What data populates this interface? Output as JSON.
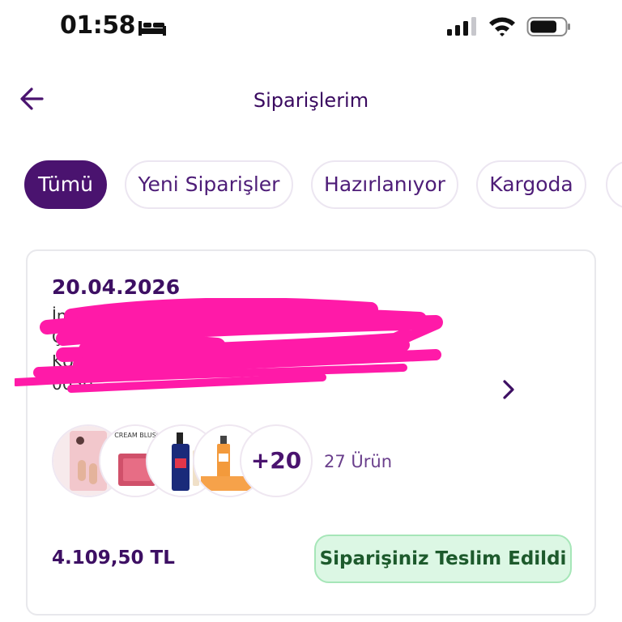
{
  "status_bar": {
    "time": "01:58"
  },
  "header": {
    "title": "Siparişlerim"
  },
  "tabs": [
    {
      "label": "Tümü"
    },
    {
      "label": "Yeni Siparişler"
    },
    {
      "label": "Hazırlanıyor"
    },
    {
      "label": "Kargoda"
    }
  ],
  "order": {
    "date": "20.04.2026",
    "address_lines": [
      "İnt                                     Apartmanı",
      "Çe                                         ",
      "KUCU                                          NBUL,",
      "0050                    "
    ],
    "thumbnail_labels": {
      "cream_blush": "CREAM BLUSH"
    },
    "more_count": "+20",
    "item_count": "27 Ürün",
    "total": "4.109,50 TL",
    "status": "Siparişiniz Teslim Edildi"
  },
  "colors": {
    "brand_purple": "#4a136f",
    "title_purple": "#3a0a60",
    "delivered_bg": "#dcf7e4",
    "delivered_border": "#a6e6b8",
    "redaction_pink": "#ff1aa8"
  },
  "icons": [
    "bed-icon",
    "signal-icon",
    "wifi-icon",
    "battery-icon",
    "back-arrow-icon",
    "chevron-right-icon"
  ]
}
